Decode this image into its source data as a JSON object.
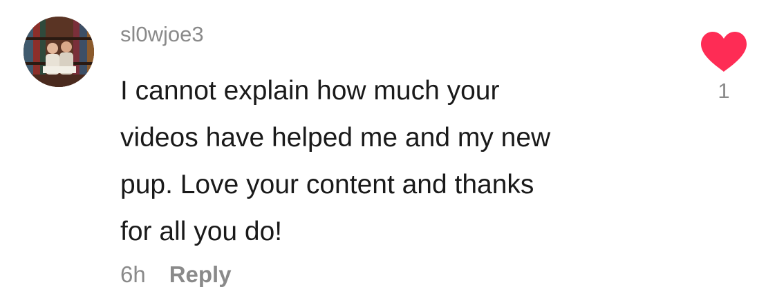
{
  "comment": {
    "username": "sl0wjoe3",
    "text": "I cannot explain how much your\nvideos have helped me and my new\npup. Love your content and thanks\nfor all you do!",
    "timestamp": "6h",
    "reply_label": "Reply",
    "like_count": "1",
    "avatar_icon": "user-photo-avatar",
    "like_icon": "heart-icon"
  },
  "colors": {
    "heart": "#fe2c55",
    "muted_text": "#8a8a8a",
    "body_text": "#1a1a1a"
  }
}
